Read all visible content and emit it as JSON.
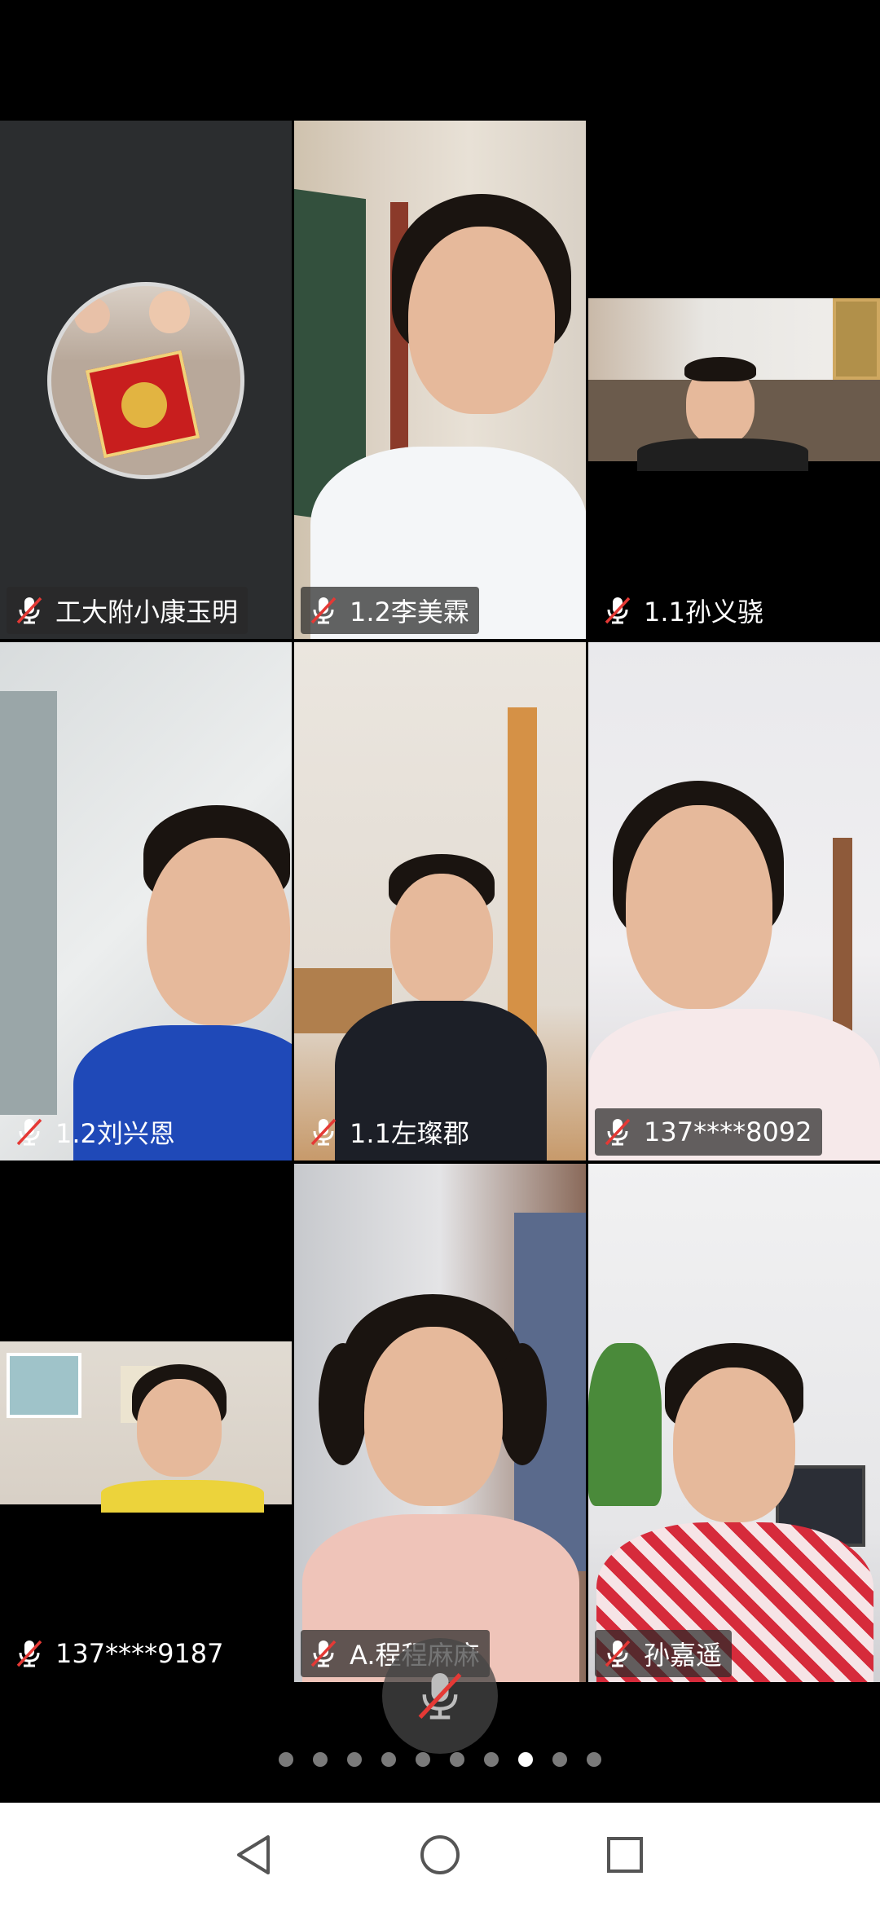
{
  "participants": [
    {
      "name": "工大附小康玉明",
      "muted": true
    },
    {
      "name": "1.2李美霖",
      "muted": true
    },
    {
      "name": "1.1孙义骁",
      "muted": true
    },
    {
      "name": "1.2刘兴恩",
      "muted": true
    },
    {
      "name": "1.1左璨郡",
      "muted": true
    },
    {
      "name": "137****8092",
      "muted": true
    },
    {
      "name": "137****9187",
      "muted": true
    },
    {
      "name": "A.程程麻麻",
      "muted": true
    },
    {
      "name": "孙嘉遥",
      "muted": true
    }
  ],
  "pager": {
    "total": 10,
    "active_index": 7
  },
  "controls": {
    "mic_state": "muted"
  },
  "icons": {
    "tile_mic": "mic-muted-icon",
    "main_mic": "mic-muted-icon",
    "nav_back": "back-triangle-icon",
    "nav_home": "home-circle-icon",
    "nav_recent": "recent-square-icon"
  },
  "colors": {
    "muted_slash": "#e53935",
    "background": "#000000",
    "label_bg": "#282828"
  }
}
